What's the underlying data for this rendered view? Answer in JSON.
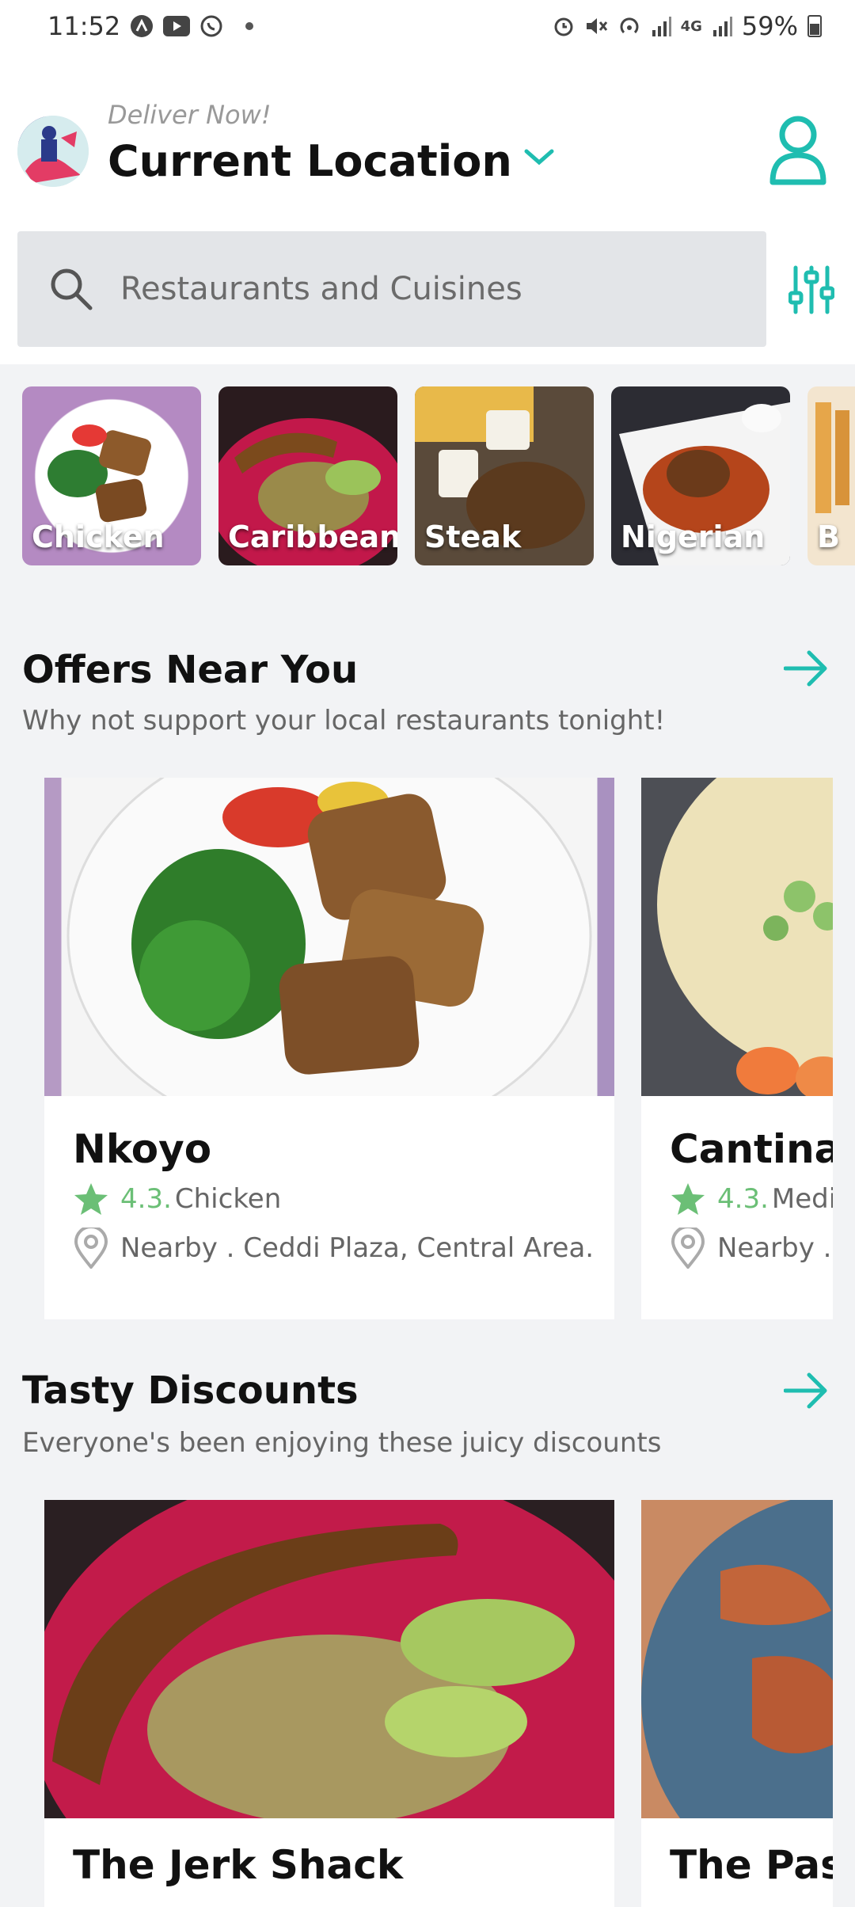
{
  "status_bar": {
    "time": "11:52",
    "battery": "59%",
    "left_icons": [
      "notification-a-icon",
      "youtube-icon",
      "whatsapp-icon"
    ],
    "right_icons": [
      "alarm-icon",
      "mute-icon",
      "hotspot-icon",
      "signal-icon",
      "4g-icon",
      "signal-icon"
    ]
  },
  "header": {
    "deliver_label": "Deliver Now!",
    "location": "Current Location"
  },
  "search": {
    "placeholder": "Restaurants and Cuisines"
  },
  "cuisines": [
    {
      "label": "Chicken"
    },
    {
      "label": "Caribbean"
    },
    {
      "label": "Steak"
    },
    {
      "label": "Nigerian"
    },
    {
      "label": "B"
    }
  ],
  "offers": {
    "title": "Offers Near You",
    "subtitle": "Why not support your local restaurants tonight!",
    "cards": [
      {
        "name": "Nkoyo",
        "rating": "4.3.",
        "category": "Chicken",
        "address": "Nearby . Ceddi Plaza, Central Area."
      },
      {
        "name": "Cantina",
        "rating": "4.3.",
        "category": "Medi",
        "address": "Nearby ."
      }
    ]
  },
  "discounts": {
    "title": "Tasty Discounts",
    "subtitle": "Everyone's been enjoying these juicy discounts",
    "cards": [
      {
        "name": "The Jerk Shack"
      },
      {
        "name": "The Pash"
      }
    ]
  },
  "colors": {
    "accent": "#1fbdb0",
    "rating": "#6bbf76"
  }
}
